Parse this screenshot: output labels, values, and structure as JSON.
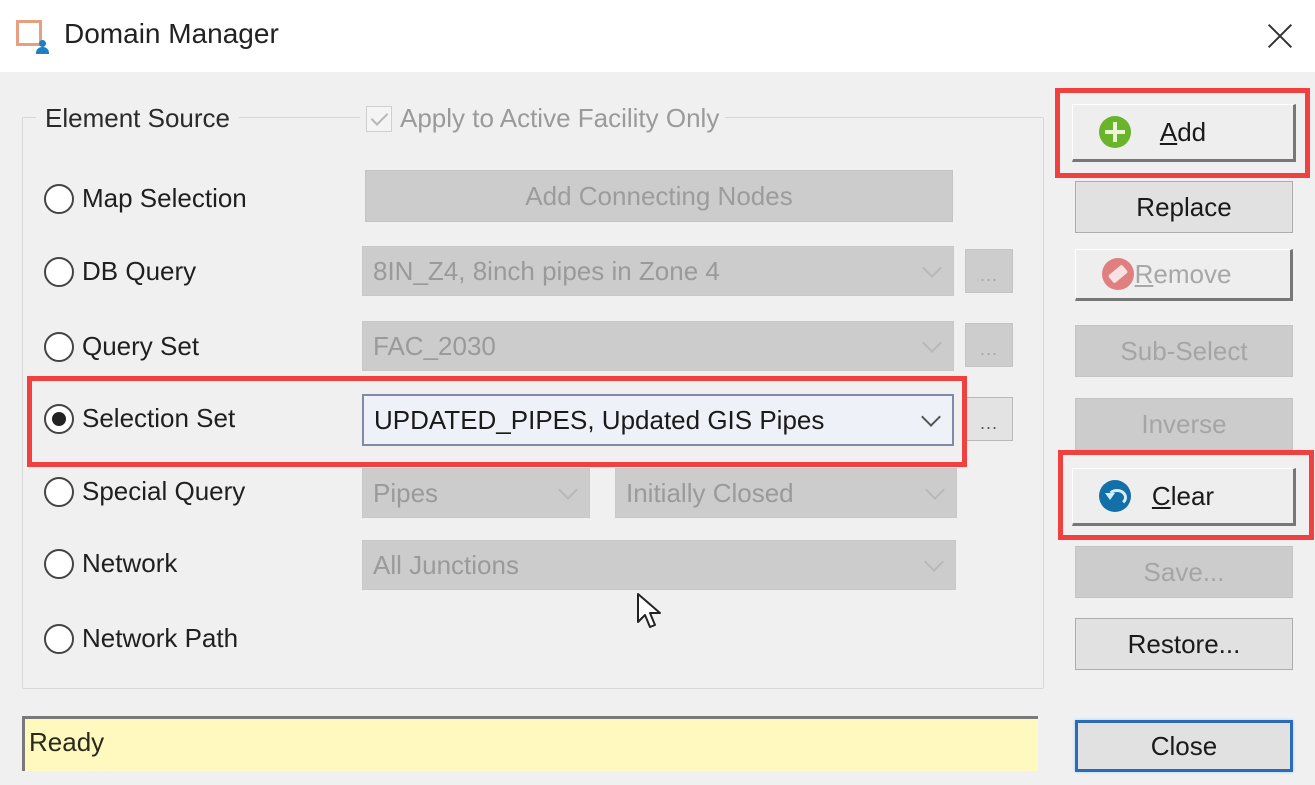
{
  "window": {
    "title": "Domain Manager",
    "icon": "domain-manager-app-icon",
    "close_icon": "close-x-icon"
  },
  "element_source": {
    "group_label": "Element Source",
    "apply_checkbox": {
      "label": "Apply to Active Facility Only",
      "checked": true,
      "enabled": false
    },
    "options": [
      {
        "label": "Map Selection",
        "selected": false
      },
      {
        "label": "DB Query",
        "selected": false
      },
      {
        "label": "Query Set",
        "selected": false
      },
      {
        "label": "Selection Set",
        "selected": true
      },
      {
        "label": "Special Query",
        "selected": false
      },
      {
        "label": "Network",
        "selected": false
      },
      {
        "label": "Network Path",
        "selected": false
      }
    ],
    "add_connecting_nodes_label": "Add Connecting Nodes",
    "db_query_value": "8IN_Z4, 8inch pipes in Zone 4",
    "query_set_value": "FAC_2030",
    "selection_set_value": "UPDATED_PIPES, Updated GIS Pipes",
    "special_query_type": "Pipes",
    "special_query_value": "Initially Closed",
    "network_value": "All Junctions",
    "ellipsis_label": "..."
  },
  "actions": {
    "add": {
      "label": "Add",
      "mnemonic": "A",
      "icon": "plus-circle-icon"
    },
    "replace": {
      "label": "Replace"
    },
    "remove": {
      "label": "Remove",
      "mnemonic": "R",
      "icon": "eraser-icon"
    },
    "sub_select": {
      "label": "Sub-Select"
    },
    "inverse": {
      "label": "Inverse"
    },
    "clear": {
      "label": "Clear",
      "mnemonic": "C",
      "icon": "undo-circle-icon"
    },
    "save": {
      "label": "Save..."
    },
    "restore": {
      "label": "Restore..."
    },
    "close": {
      "label": "Close"
    }
  },
  "status_bar": {
    "text": "Ready"
  },
  "annotations": {
    "highlight_color": "#f04040"
  }
}
